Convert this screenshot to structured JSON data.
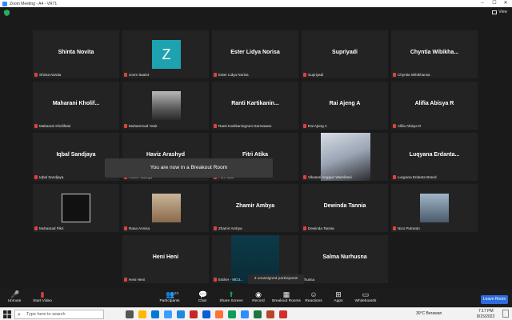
{
  "window": {
    "title": "Zoom Meeting - A4 - VR71",
    "view_label": "View"
  },
  "tiles": [
    {
      "big": "Shinta Novita",
      "label": "Shinta Novita"
    },
    {
      "avatar": "Z",
      "label": "zoom 8aa04"
    },
    {
      "big": "Ester Lidya Norisa",
      "label": "Ester Lidya Norisa"
    },
    {
      "big": "Supriyadi",
      "label": "Supriyadi"
    },
    {
      "big": "Chyntia Wibikha...",
      "label": "Chyntia Wibikhansa"
    },
    {
      "big": "Maharani Kholif...",
      "label": "Maharani Kholifatul"
    },
    {
      "label": "Muhammad Yasir"
    },
    {
      "big": "Ranti Kartikanin...",
      "label": "Ranti Kartikaningrum Darmawan"
    },
    {
      "big": "Rai Ajeng A",
      "label": "Rai Ajeng A"
    },
    {
      "big": "Alifia Abisya R",
      "label": "Alifia Abisya R"
    },
    {
      "big": "Iqbal Sandjaya",
      "label": "Iqbal Sandjaya"
    },
    {
      "big": "Haviz Arashyd",
      "label": "Haviz Arashyd"
    },
    {
      "big": "Fitri Atika",
      "label": "Fitri Atika"
    },
    {
      "label": "Vikasari Anggun Warsihani"
    },
    {
      "big": "Luqyana Erdanta...",
      "label": "Luqyana Erdanta Brand"
    },
    {
      "label": "Muhamad Fikri"
    },
    {
      "label": "Rana Annisa"
    },
    {
      "big": "Zhamir Ambya",
      "label": "Zhamir Ambya"
    },
    {
      "big": "Dewinda Tannia",
      "label": "Dewinda Tannia"
    },
    {
      "label": "Nico Putranto"
    },
    {
      "big": "Heni Heni",
      "label": "Heni Heni"
    },
    {
      "label": "Esther - MOJ..."
    },
    {
      "big": "Salma Nurhusna",
      "label": "rhusna"
    }
  ],
  "toast": "You are now in a Breakout Room",
  "popup": "3 unassigned participants",
  "toolbar": {
    "unmute": "Unmute",
    "start_video": "Start Video",
    "participants": "Participants",
    "participants_count": "23",
    "chat": "Chat",
    "share_screen": "Share Screen",
    "record": "Record",
    "breakout_rooms": "Breakout Rooms",
    "reactions": "Reactions",
    "apps": "Apps",
    "whiteboards": "Whiteboards",
    "leave": "Leave Room"
  },
  "taskbar": {
    "search_placeholder": "Type here to search",
    "weather": "30°C  Berawan",
    "time": "7:17 PM",
    "date": "8/15/2022"
  },
  "colors": {
    "accent": "#2d8cff",
    "share_green": "#0e9f4f",
    "leave_blue": "#2d6cdf",
    "muted_red": "#e0403c"
  }
}
